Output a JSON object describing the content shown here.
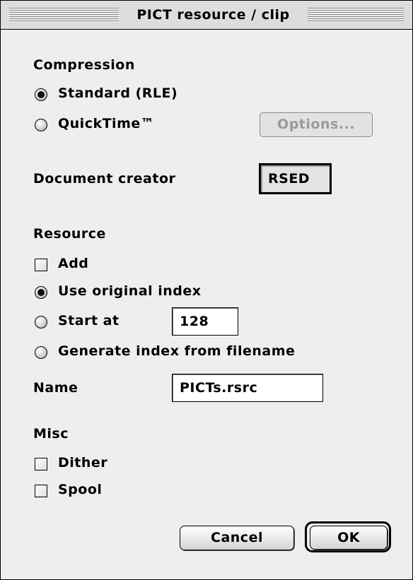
{
  "window": {
    "title": "PICT resource / clip"
  },
  "compression": {
    "heading": "Compression",
    "options": [
      {
        "label": "Standard (RLE)",
        "selected": true
      },
      {
        "label": "QuickTime™",
        "selected": false
      }
    ],
    "options_button": "Options...",
    "options_button_enabled": false
  },
  "creator": {
    "label": "Document creator",
    "value": "RSED"
  },
  "resource": {
    "heading": "Resource",
    "add": {
      "label": "Add",
      "checked": false
    },
    "index_options": [
      {
        "label": "Use original index",
        "selected": true
      },
      {
        "label": "Start at",
        "selected": false
      },
      {
        "label": "Generate index from filename",
        "selected": false
      }
    ],
    "start_value": "128",
    "name_label": "Name",
    "name_value": "PICTs.rsrc"
  },
  "misc": {
    "heading": "Misc",
    "options": [
      {
        "label": "Dither",
        "checked": false
      },
      {
        "label": "Spool",
        "checked": false
      }
    ]
  },
  "buttons": {
    "cancel": "Cancel",
    "ok": "OK",
    "default": "OK"
  }
}
